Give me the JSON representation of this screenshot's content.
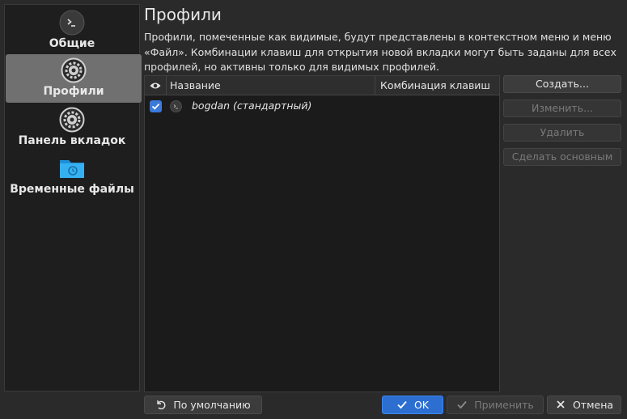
{
  "sidebar": {
    "items": [
      {
        "label": "Общие",
        "icon": "terminal-icon"
      },
      {
        "label": "Профили",
        "icon": "gear-icon"
      },
      {
        "label": "Панель вкладок",
        "icon": "gear-icon"
      },
      {
        "label": "Временные файлы",
        "icon": "folder-clock-icon"
      }
    ]
  },
  "page": {
    "title": "Профили",
    "description_line1": "Профили, помеченные как видимые, будут представлены в контекстном меню и меню",
    "description_line2": "«Файл». Комбинации клавиш для открытия новой вкладки могут быть заданы для всех",
    "description_line3": "профилей, но активны только для видимых профилей."
  },
  "table": {
    "columns": {
      "visible_icon": "eye-icon",
      "name": "Название",
      "shortcut": "Комбинация клавиш"
    },
    "rows": [
      {
        "visible": true,
        "name": "bogdan (стандартный)",
        "shortcut": ""
      }
    ]
  },
  "actions": {
    "create": "Создать...",
    "edit": "Изменить...",
    "delete": "Удалить",
    "set_default": "Сделать основным"
  },
  "footer": {
    "defaults": "По умолчанию",
    "ok": "OK",
    "apply": "Применить",
    "cancel": "Отмена"
  },
  "colors": {
    "accent": "#2c6fd1",
    "selected_sidebar": "#707070",
    "background": "#2a2a2a"
  }
}
